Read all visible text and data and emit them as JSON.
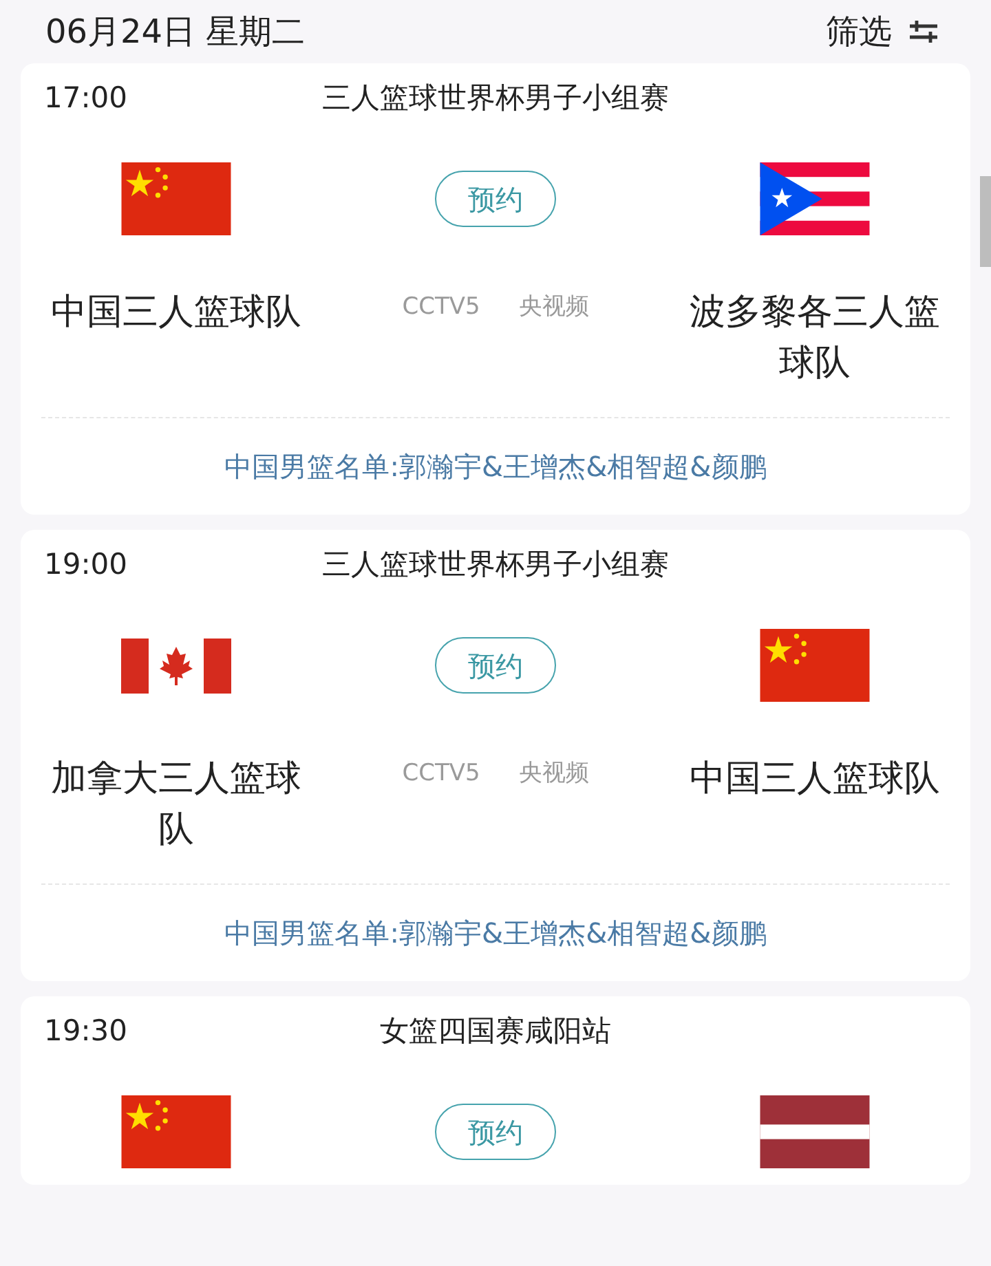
{
  "header": {
    "date": "06月24日 星期二",
    "filter_label": "筛选"
  },
  "matches": [
    {
      "time": "17:00",
      "title": "三人篮球世界杯男子小组赛",
      "home": {
        "kind": "cn",
        "name": "中国三人篮球队"
      },
      "away": {
        "kind": "pr",
        "name": "波多黎各三人篮球队"
      },
      "button": "预约",
      "channels": [
        "CCTV5",
        "央视频"
      ],
      "note": "中国男篮名单:郭瀚宇&王增杰&相智超&颜鹏"
    },
    {
      "time": "19:00",
      "title": "三人篮球世界杯男子小组赛",
      "home": {
        "kind": "ca",
        "name": "加拿大三人篮球队"
      },
      "away": {
        "kind": "cn",
        "name": "中国三人篮球队"
      },
      "button": "预约",
      "channels": [
        "CCTV5",
        "央视频"
      ],
      "note": "中国男篮名单:郭瀚宇&王增杰&相智超&颜鹏"
    },
    {
      "time": "19:30",
      "title": "女篮四国赛咸阳站",
      "home": {
        "kind": "cn"
      },
      "away": {
        "kind": "lv"
      },
      "button": "预约"
    }
  ]
}
